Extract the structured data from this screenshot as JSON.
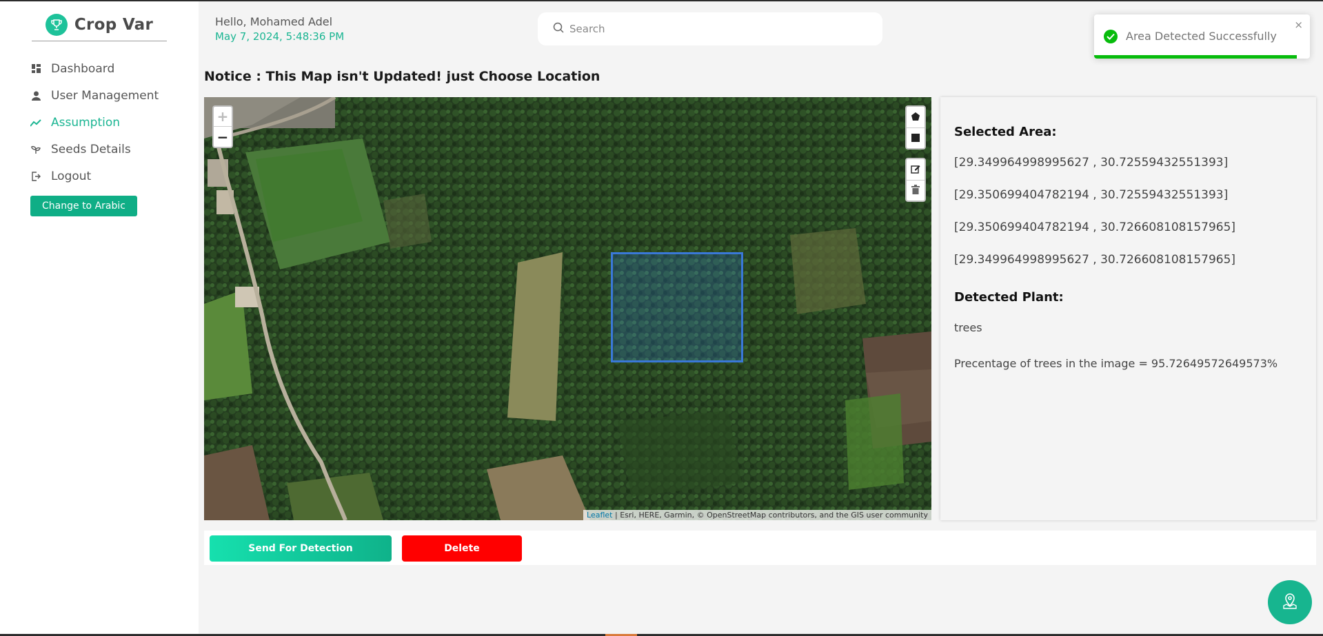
{
  "app": {
    "name": "Crop Var"
  },
  "sidebar": {
    "items": [
      {
        "label": "Dashboard",
        "icon": "dashboard-icon",
        "active": false
      },
      {
        "label": "User Management",
        "icon": "user-icon",
        "active": false
      },
      {
        "label": "Assumption",
        "icon": "trend-icon",
        "active": true
      },
      {
        "label": "Seeds Details",
        "icon": "seed-icon",
        "active": false
      },
      {
        "label": "Logout",
        "icon": "logout-icon",
        "active": false
      }
    ],
    "language_button": "Change to Arabic"
  },
  "header": {
    "greeting": "Hello, Mohamed Adel",
    "datetime": "May 7, 2024, 5:48:36 PM",
    "search_placeholder": "Search"
  },
  "notice": "Notice : This Map isn't Updated! just Choose Location",
  "map": {
    "zoom_in": "+",
    "zoom_out": "−",
    "attribution_leaflet": "Leaflet",
    "attribution_rest": " | Esri, HERE, Garmin, © OpenStreetMap contributors, and the GIS user community"
  },
  "panel": {
    "selected_area_title": "Selected Area:",
    "coordinates": [
      "[29.349964998995627 , 30.72559432551393]",
      "[29.350699404782194 , 30.72559432551393]",
      "[29.350699404782194 , 30.726608108157965]",
      "[29.349964998995627 , 30.726608108157965]"
    ],
    "detected_plant_title": "Detected Plant:",
    "plant": "trees",
    "percentage": "Precentage of trees in the image = 95.72649572649573%"
  },
  "actions": {
    "send_label": "Send For Detection",
    "delete_label": "Delete"
  },
  "toast": {
    "message": "Area Detected Successfully",
    "close": "×",
    "progress": 0.94
  },
  "colors": {
    "accent": "#1ab592",
    "danger": "#ff0000",
    "success": "#07bc0c"
  }
}
